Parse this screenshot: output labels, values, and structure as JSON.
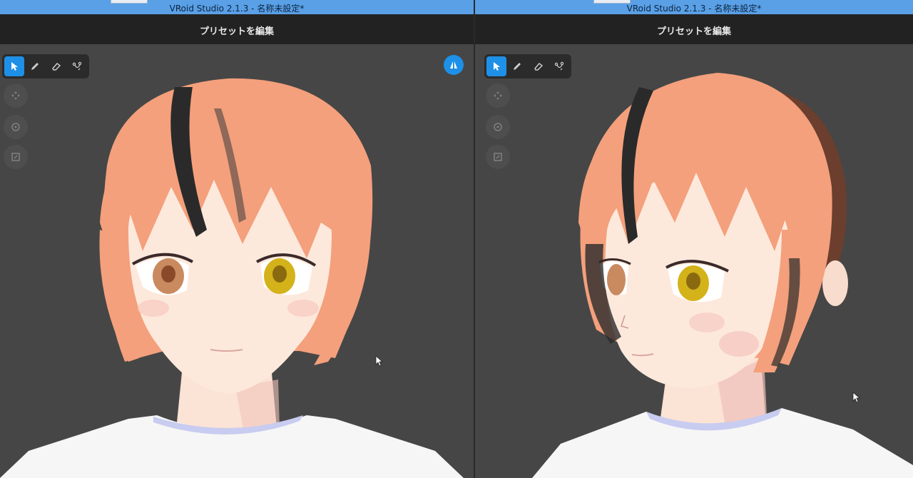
{
  "window": {
    "title_left": "VRoid Studio 2.1.3 - 名称未設定*",
    "title_right": "VRoid Studio 2.1.3 - 名称未設定*"
  },
  "header": {
    "title_left": "プリセットを編集",
    "title_right": "プリセットを編集"
  },
  "toolbar": {
    "tools": [
      "select-tool",
      "brush-tool",
      "eraser-tool",
      "guide-tool"
    ],
    "active_tool": "select-tool"
  },
  "side_buttons": [
    "move-view-icon",
    "rotate-view-icon",
    "zoom-view-icon"
  ],
  "colors": {
    "accent": "#1e90e8",
    "hair": "#f4a07c",
    "hair_shadow": "#2a2a2a",
    "skin": "#fce9dc",
    "shirt": "#f6f6f6",
    "eye_left": "#c98a60",
    "eye_right": "#d4b21a"
  }
}
